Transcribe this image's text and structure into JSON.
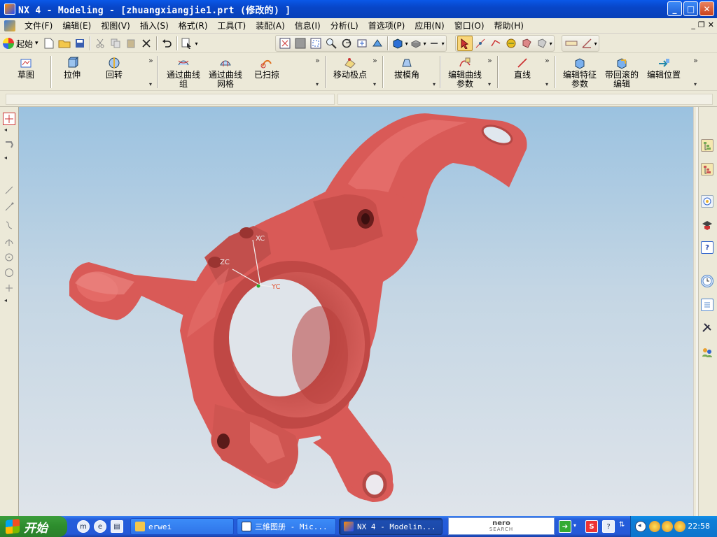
{
  "window": {
    "title": "NX 4 - Modeling - [zhuangxiangjie1.prt  (修改的) ]",
    "buttons": {
      "minimize": "_",
      "maximize": "□",
      "close": "✕"
    }
  },
  "menubar": {
    "items": [
      "文件(F)",
      "编辑(E)",
      "视图(V)",
      "插入(S)",
      "格式(R)",
      "工具(T)",
      "装配(A)",
      "信息(I)",
      "分析(L)",
      "首选项(P)",
      "应用(N)",
      "窗口(O)",
      "帮助(H)"
    ],
    "mdi": {
      "minimize": "_",
      "restore": "❐",
      "close": "✕"
    }
  },
  "toolbar": {
    "start_label": "起始",
    "start_arrow": "▾"
  },
  "feature_toolbar": {
    "buttons": [
      "草图",
      "拉伸",
      "回转",
      "通过曲线\n组",
      "通过曲线\n网格",
      "已扫掠",
      "移动极点",
      "拔模角",
      "编辑曲线\n参数",
      "直线",
      "编辑特征\n参数",
      "带回滚的\n编辑",
      "编辑位置"
    ],
    "more": "»",
    "dropdown": "▾"
  },
  "viewport": {
    "axes": {
      "xc": "XC",
      "yc": "YC",
      "zc": "ZC"
    },
    "model_color": "#d95a57"
  },
  "taskbar": {
    "start_label": "开始",
    "tasks": [
      "erwei",
      "三維图册 - Mic...",
      "NX 4 - Modelin..."
    ],
    "nero_top": "nero",
    "nero_bottom": "SEARCH",
    "clock": "22:58"
  }
}
